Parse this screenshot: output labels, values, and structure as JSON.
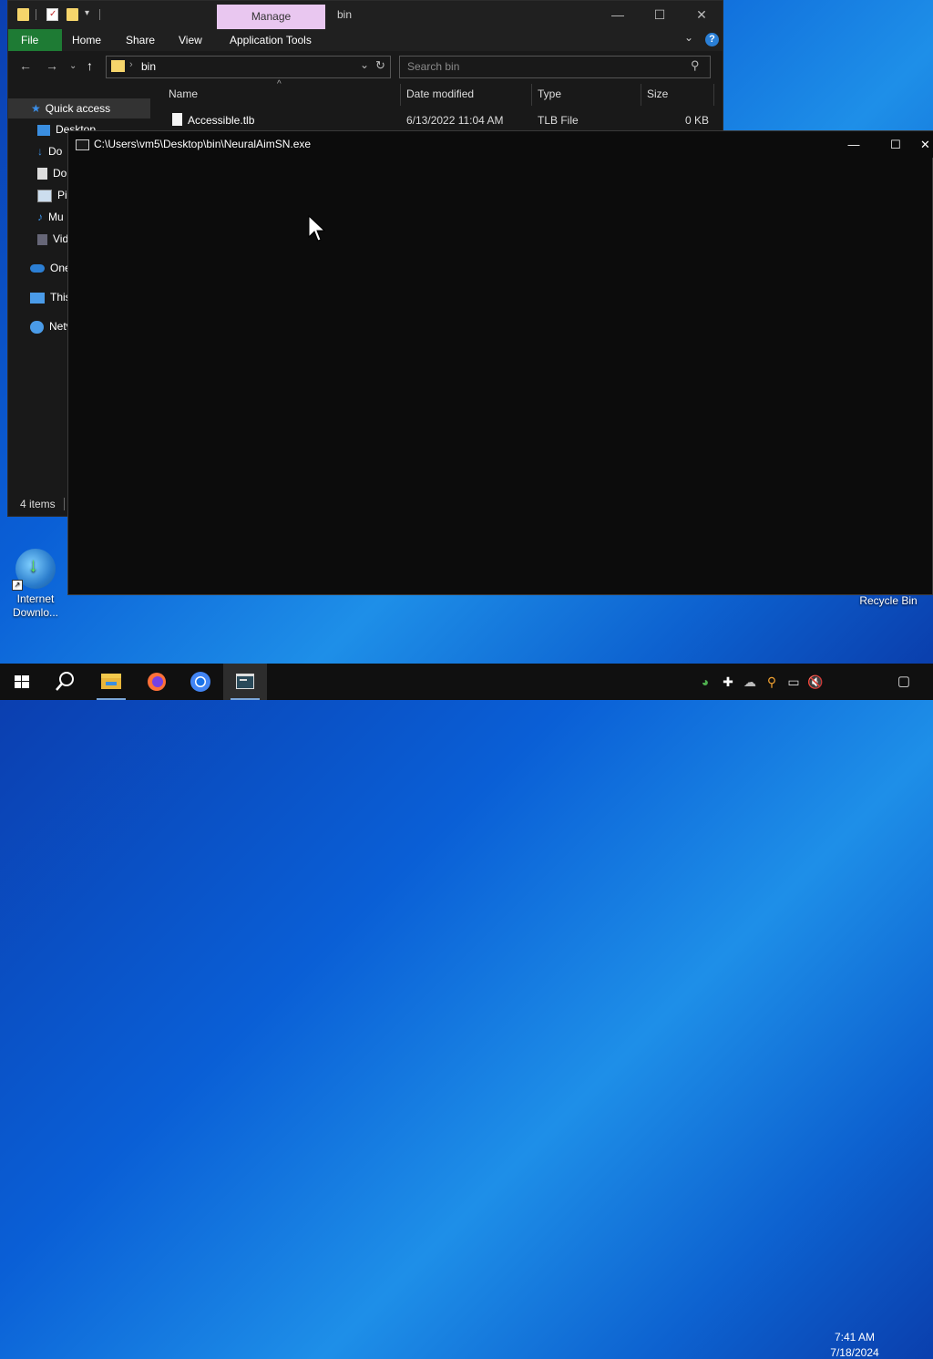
{
  "explorer": {
    "title": "bin",
    "contextual_tab": "Manage",
    "ribbon_tabs": {
      "file": "File",
      "home": "Home",
      "share": "Share",
      "view": "View",
      "app_tools": "Application Tools"
    },
    "help": "?",
    "address": "bin",
    "search_placeholder": "Search bin",
    "nav_items": {
      "quick_access": "Quick access",
      "desktop": "Desktop",
      "downloads": "Do",
      "documents": "Do",
      "pictures": "Pic",
      "music": "Mu",
      "videos": "Vid",
      "onedrive": "One",
      "this_pc": "This",
      "network": "Netv"
    },
    "columns": {
      "name": "Name",
      "date": "Date modified",
      "type": "Type",
      "size": "Size"
    },
    "files": [
      {
        "name": "Accessible.tlb",
        "date": "6/13/2022 11:04 AM",
        "type": "TLB File",
        "size": "0 KB"
      }
    ],
    "status": "4 items"
  },
  "console": {
    "title": "C:\\Users\\vm5\\Desktop\\bin\\NeuralAimSN.exe"
  },
  "desktop_icons": {
    "idm_line1": "Internet",
    "idm_line2": "Downlo...",
    "recycle_bin": "Recycle Bin"
  },
  "taskbar": {
    "time": "7:41 AM",
    "date": "7/18/2024"
  },
  "colors": {
    "file_tab": "#1e7b34",
    "manage_tab": "#e9c7f0",
    "taskbar": "#101010",
    "console_bg": "#0c0c0c"
  }
}
